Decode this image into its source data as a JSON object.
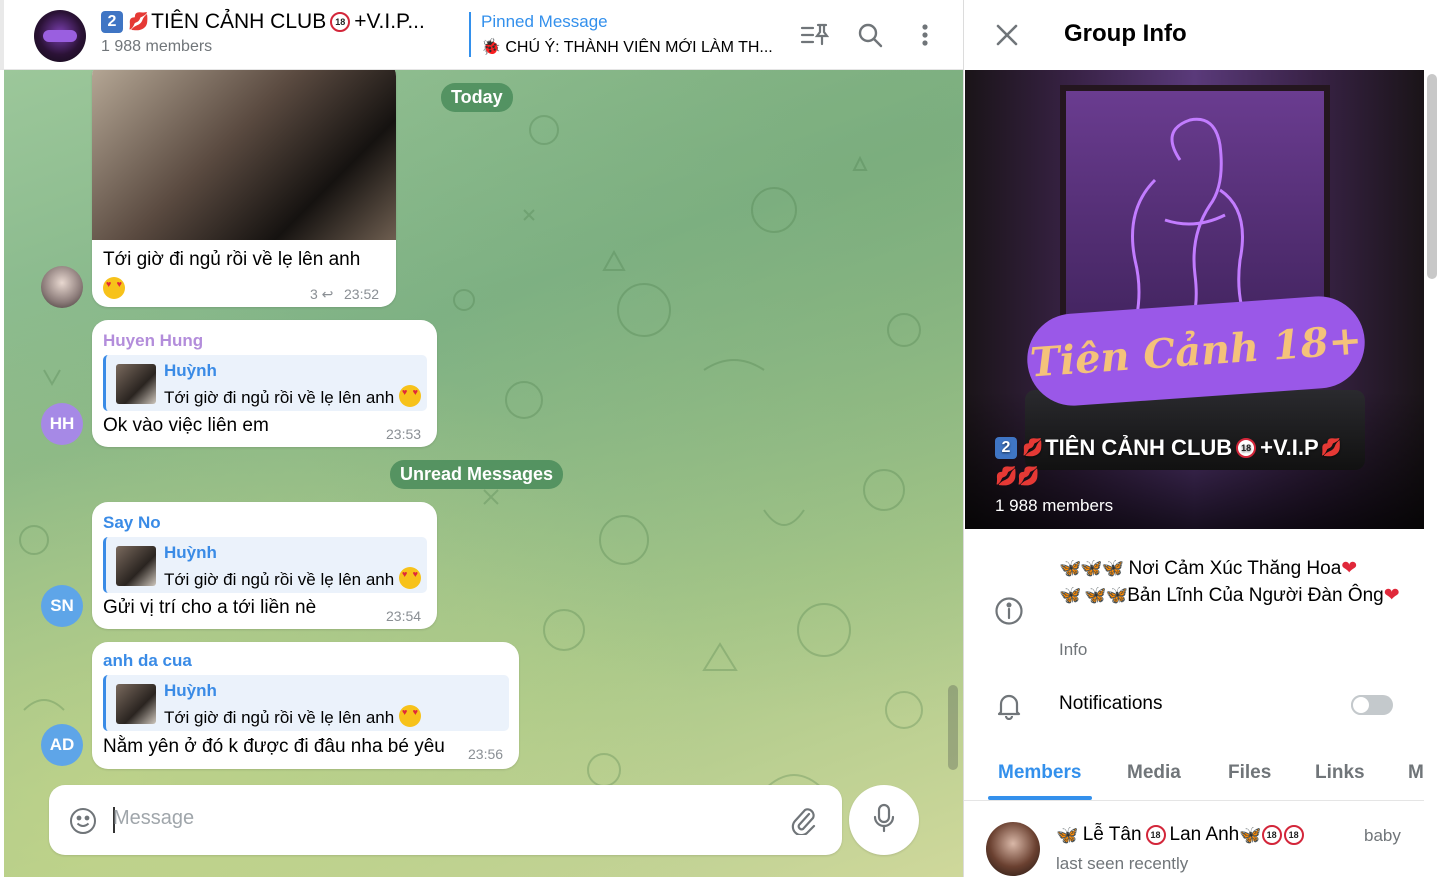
{
  "chat": {
    "title_num": "2",
    "title": "TIÊN CẢNH CLUB",
    "title_vip": "+V.I.P...",
    "members": "1 988 members",
    "pinned_label": "Pinned Message",
    "pinned_text": "🐞 CHÚ Ý: THÀNH VIÊN MỚI LÀM TH...",
    "date_today": "Today",
    "unread_label": "Unread Messages",
    "input_placeholder": "Message"
  },
  "messages": [
    {
      "text": "Tới giờ đi ngủ rồi về lẹ lên anh",
      "replies": "3",
      "time": "23:52"
    },
    {
      "sender": "Huyen Hung",
      "sender_color": "#b38ddb",
      "reply_name": "Huỳnh",
      "reply_text": "Tới giờ đi ngủ rồi về lẹ lên anh",
      "text": "Ok vào việc liên em",
      "time": "23:53",
      "avatar": "HH",
      "avatar_color": "#a689e6"
    },
    {
      "sender": "Say No",
      "sender_color": "#3a8be6",
      "reply_name": "Huỳnh",
      "reply_text": "Tới giờ đi ngủ rồi về lẹ lên anh",
      "text": "Gửi vị trí cho a tới liền nè",
      "time": "23:54",
      "avatar": "SN",
      "avatar_color": "#5ea5e8"
    },
    {
      "sender": "anh da cua",
      "sender_color": "#3a8be6",
      "reply_name": "Huỳnh",
      "reply_text": "Tới giờ đi ngủ rồi về lẹ lên anh",
      "text": "Nằm yên ở đó k được đi đâu nha bé yêu",
      "time": "23:56",
      "avatar": "AD",
      "avatar_color": "#5ea5e8"
    }
  ],
  "info": {
    "title": "Group Info",
    "cover_banner": "Tiên Cảnh 18+",
    "group_num": "2",
    "group_name": "TIÊN CẢNH CLUB",
    "group_vip": "+V.I.P",
    "group_members": "1 988 members",
    "about_line1": "Nơi Cảm Xúc Thăng Hoa",
    "about_line2": "Bản Lĩnh Của Người Đàn Ông",
    "about_caption": "Info",
    "notifications_label": "Notifications",
    "tabs": [
      "Members",
      "Media",
      "Files",
      "Links",
      "M"
    ],
    "member_name_a": "Lễ Tân",
    "member_name_b": "Lan Anh",
    "member_status": "last seen recently",
    "member_role": "baby"
  },
  "icons": {
    "close": "close-icon",
    "search": "search-icon",
    "more": "more-vertical-icon",
    "pin_list": "pinned-list-icon",
    "info": "info-icon",
    "bell": "bell-icon",
    "emoji": "emoji-icon",
    "attach": "paperclip-icon",
    "mic": "microphone-icon"
  },
  "colors": {
    "accent": "#3390ec",
    "badge": "#3f75c4",
    "kiss": "#d3263a"
  }
}
